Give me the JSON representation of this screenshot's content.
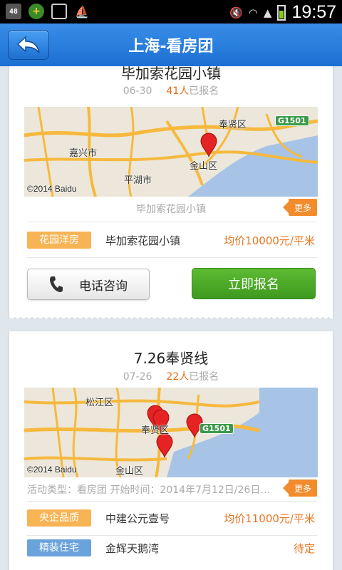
{
  "status_bar": {
    "time": "19:57",
    "left_icons": [
      "48",
      "plus-icon",
      "image-icon",
      "boat-icon"
    ],
    "left_label": "48"
  },
  "header": {
    "title": "上海-看房团"
  },
  "tours": [
    {
      "title": "毕加索花园小镇",
      "date": "06-30",
      "count": "41人",
      "count_suffix": "已报名",
      "map": {
        "labels": [
          "嘉兴市",
          "奉贤区",
          "金山区",
          "平湖市"
        ],
        "credit_year": "2014",
        "credit_brand": "Baidu",
        "road_shield": "G1501"
      },
      "description": "毕加索花园小镇",
      "more_label": "更多",
      "properties": [
        {
          "tag": "花园洋房",
          "tag_color": "#f7b455",
          "name": "毕加索花园小镇",
          "price": "均价10000元/平米"
        }
      ],
      "call_label": "电话咨询",
      "signup_label": "立即报名"
    },
    {
      "title": "7.26奉贤线",
      "date": "07-26",
      "count": "22人",
      "count_suffix": "已报名",
      "map": {
        "labels": [
          "松江区",
          "奉贤区",
          "金山区"
        ],
        "credit_year": "2014",
        "credit_brand": "Baidu",
        "road_shield": "G1501"
      },
      "description": "活动类型：看房团  开始时间：2014年7月12日/26日…",
      "more_label": "更多",
      "properties": [
        {
          "tag": "央企品质",
          "tag_color": "#f7b455",
          "name": "中建公元壹号",
          "price": "均价11000元/平米"
        },
        {
          "tag": "精装住宅",
          "tag_color": "#6aa2dc",
          "name": "金辉天鹅湾",
          "price": "待定"
        }
      ]
    }
  ],
  "colors": {
    "header": "#1b6fd2",
    "accent_orange": "#e8741f",
    "signup_green": "#4aaa26",
    "background": "#dfe6ec"
  }
}
